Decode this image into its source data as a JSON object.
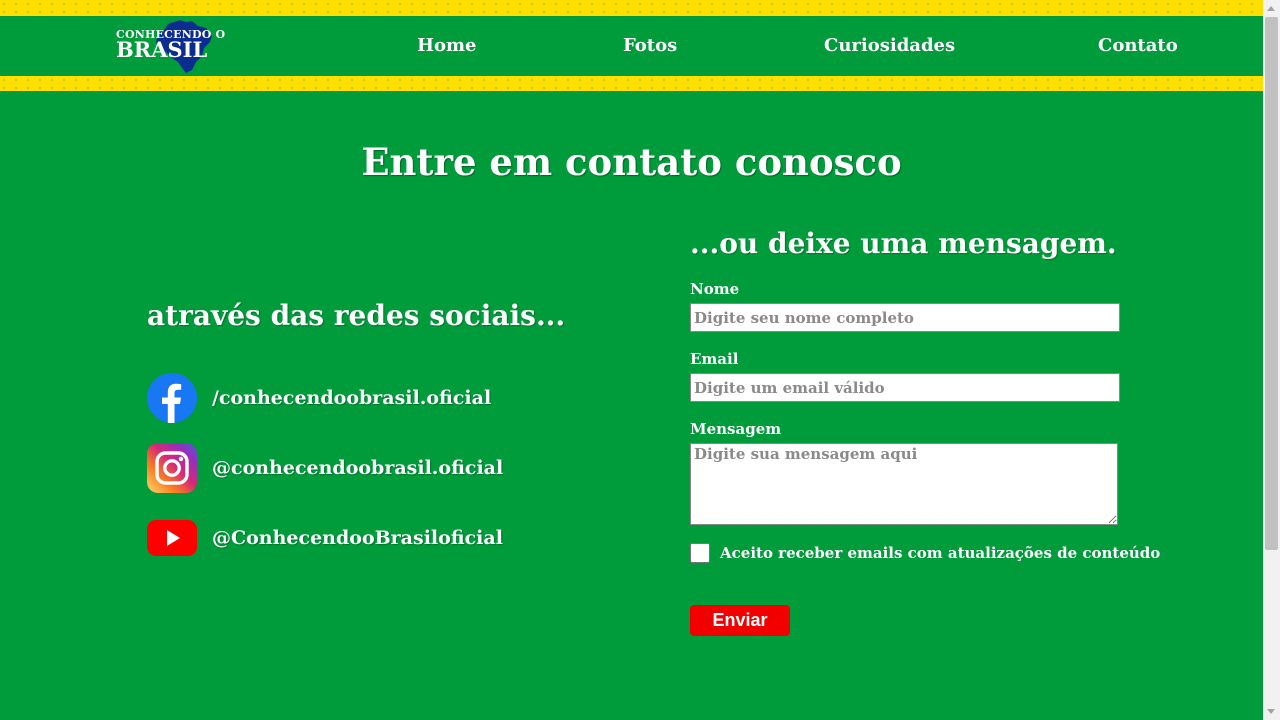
{
  "header": {
    "logo": {
      "line1": "CONHECENDO O",
      "line2": "BRASIL"
    },
    "nav": [
      {
        "label": "Home"
      },
      {
        "label": "Fotos"
      },
      {
        "label": "Curiosidades"
      },
      {
        "label": "Contato"
      }
    ]
  },
  "main": {
    "title": "Entre em contato conosco",
    "social": {
      "heading": "através das redes sociais...",
      "items": [
        {
          "icon": "facebook-icon",
          "handle": "/conhecendoobrasil.oficial"
        },
        {
          "icon": "instagram-icon",
          "handle": "@conhecendoobrasil.oficial"
        },
        {
          "icon": "youtube-icon",
          "handle": "@ConhecendooBrasiloficial"
        }
      ]
    },
    "form": {
      "heading": "...ou deixe uma mensagem.",
      "name_label": "Nome",
      "name_placeholder": "Digite seu nome completo",
      "name_value": "",
      "email_label": "Email",
      "email_placeholder": "Digite um email válido",
      "email_value": "",
      "message_label": "Mensagem",
      "message_placeholder": "Digite sua mensagem aqui",
      "message_value": "",
      "consent_label": "Aceito receber emails com atualizações de conteúdo",
      "consent_checked": false,
      "submit_label": "Enviar"
    }
  },
  "colors": {
    "brand_green": "#009c3b",
    "brand_yellow": "#fedf00",
    "submit_red": "#f20000",
    "logo_blue": "#0a2d8f"
  }
}
